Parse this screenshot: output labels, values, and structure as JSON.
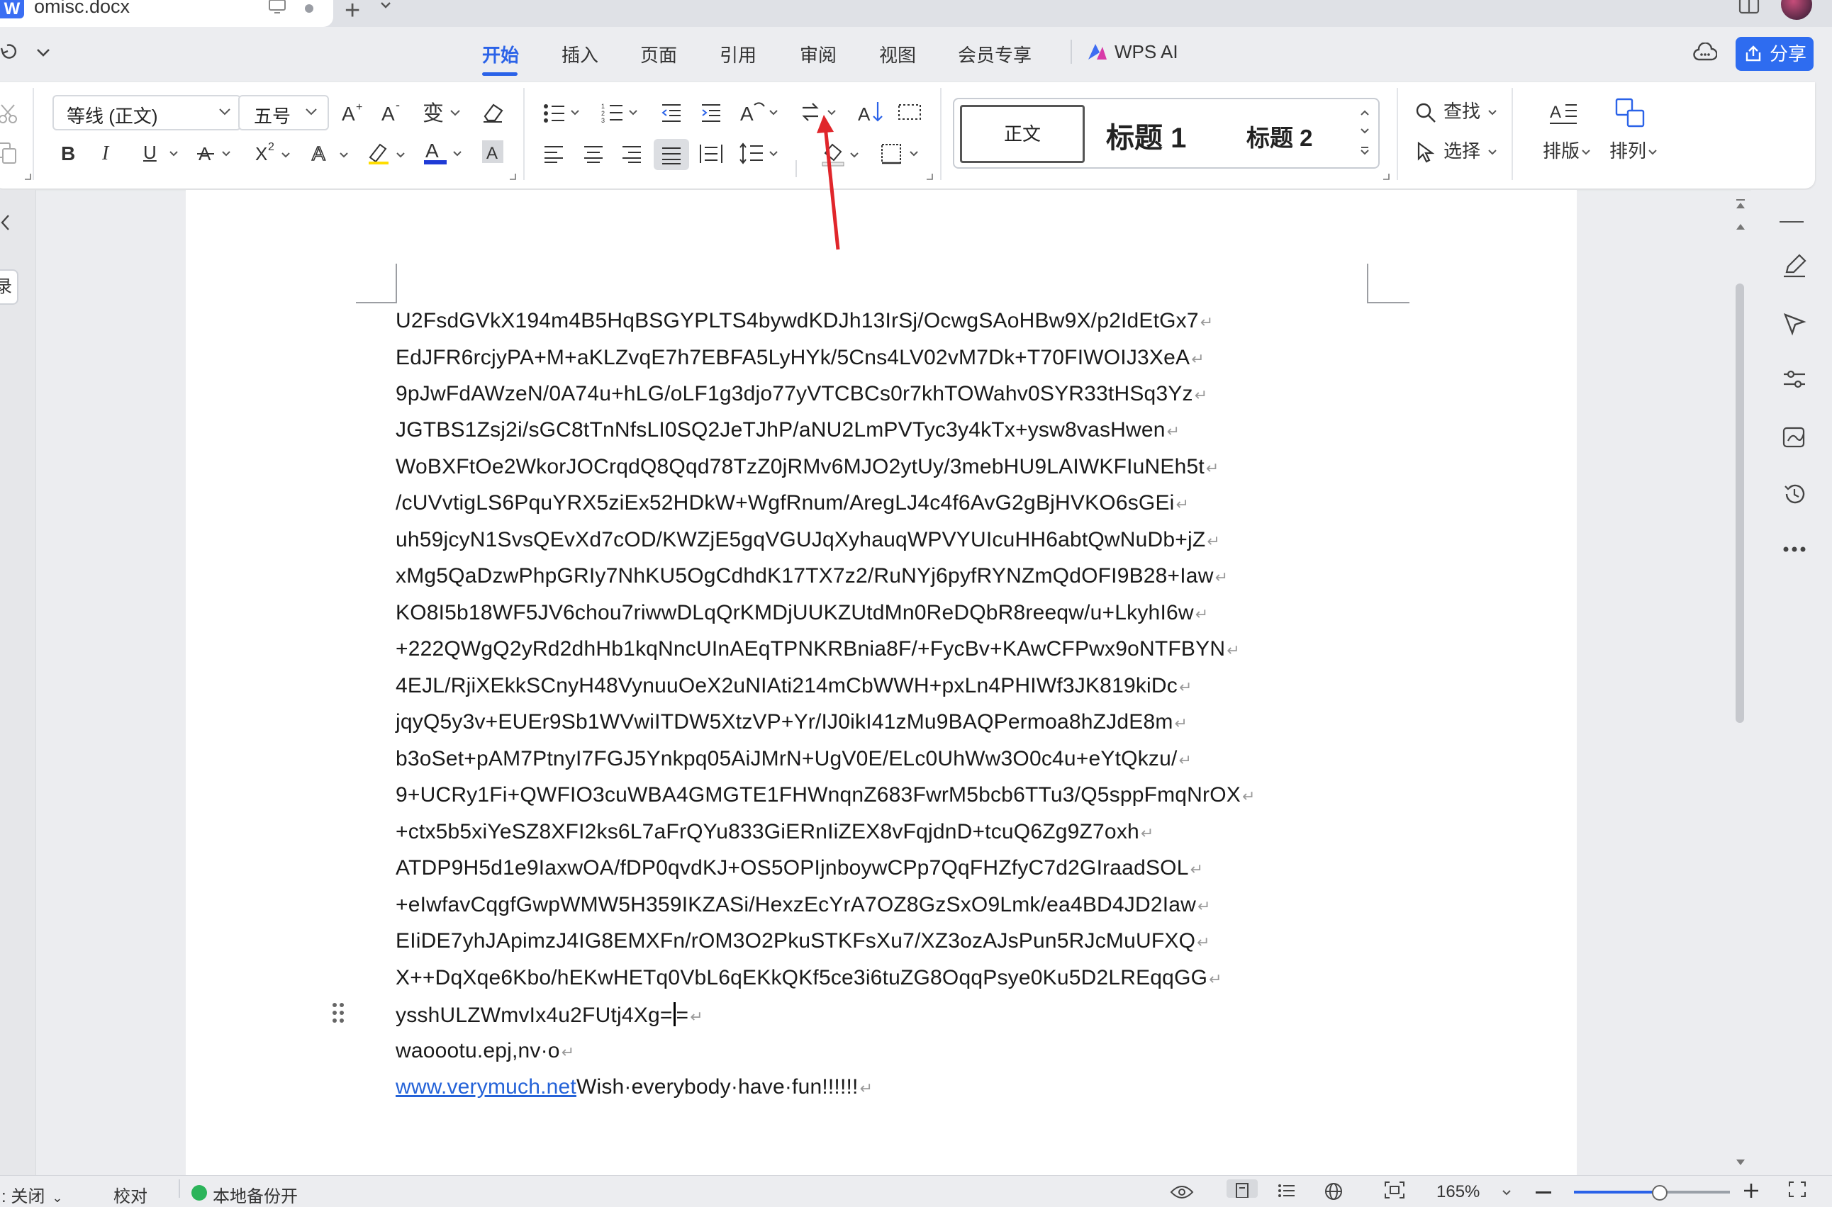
{
  "titlebar": {
    "doc_name": "omisc.docx",
    "new_tab": "+"
  },
  "menu": {
    "tabs": [
      "开始",
      "插入",
      "页面",
      "引用",
      "审阅",
      "视图",
      "会员专享"
    ],
    "active_tab": "开始",
    "wps_ai": "WPS AI",
    "share": "分享"
  },
  "ribbon": {
    "font_name": "等线 (正文)",
    "font_size": "五号",
    "bold": "B",
    "italic": "I",
    "underline": "U",
    "find": "查找",
    "select": "选择",
    "layout": "排版",
    "arrange": "排列",
    "styles": {
      "normal": "正文",
      "heading1": "标题 1",
      "heading2": "标题 2"
    }
  },
  "sidebar": {
    "toc_button": "录"
  },
  "document": {
    "lines": [
      "U2FsdGVkX194m4B5HqBSGYPLTS4bywdKDJh13IrSj/OcwgSAoHBw9X/p2IdEtGx7",
      "EdJFR6rcjyPA+M+aKLZvqE7h7EBFA5LyHYk/5Cns4LV02vM7Dk+T70FIWOIJ3XeA",
      "9pJwFdAWzeN/0A74u+hLG/oLF1g3djo77yVTCBCs0r7khTOWahv0SYR33tHSq3Yz",
      "JGTBS1Zsj2i/sGC8tTnNfsLI0SQ2JeTJhP/aNU2LmPVTyc3y4kTx+ysw8vasHwen",
      "WoBXFtOe2WkorJOCrqdQ8Qqd78TzZ0jRMv6MJO2ytUy/3mebHU9LAIWKFIuNEh5t",
      "/cUVvtigLS6PquYRX5ziEx52HDkW+WgfRnum/AregLJ4c4f6AvG2gBjHVKO6sGEi",
      "uh59jcyN1SvsQEvXd7cOD/KWZjE5gqVGUJqXyhauqWPVYUIcuHH6abtQwNuDb+jZ",
      "xMg5QaDzwPhpGRIy7NhKU5OgCdhdK17TX7z2/RuNYj6pyfRYNZmQdOFI9B28+Iaw",
      "KO8I5b18WF5JV6chou7riwwDLqQrKMDjUUKZUtdMn0ReDQbR8reeqw/u+LkyhI6w",
      "+222QWgQ2yRd2dhHb1kqNncUInAEqTPNKRBnia8F/+FycBv+KAwCFPwx9oNTFBYN",
      "4EJL/RjiXEkkSCnyH48VynuuOeX2uNIAti214mCbWWH+pxLn4PHIWf3JK819kiDc",
      "jqyQ5y3v+EUEr9Sb1WVwiITDW5XtzVP+Yr/IJ0ikI41zMu9BAQPermoa8hZJdE8m",
      "b3oSet+pAM7PtnyI7FGJ5Ynkpq05AiJMrN+UgV0E/ELc0UhWw3O0c4u+eYtQkzu/",
      "9+UCRy1Fi+QWFIO3cuWBA4GMGTE1FHWnqnZ683FwrM5bcb6TTu3/Q5sppFmqNrOX",
      "+ctx5b5xiYeSZ8XFI2ks6L7aFrQYu833GiERnIiZEX8vFqjdnD+tcuQ6Zg9Z7oxh",
      "ATDP9H5d1e9IaxwOA/fDP0qvdKJ+OS5OPIjnboywCPp7QqFHZfyC7d2GIraadSOL",
      "+eIwfavCqgfGwpWMW5H359IKZASi/HexzEcYrA7OZ8GzSxO9Lmk/ea4BD4JD2Iaw",
      "EIiDE7yhJApimzJ4IG8EMXFn/rOM3O2PkuSTKFsXu7/XZ3ozAJsPun5RJcMuUFXQ",
      "X++DqXqe6Kbo/hEKwHETq0VbL6qEKkQKf5ce3i6tuZG8OqqPsye0Ku5D2LREqqGG"
    ],
    "line_cursor_before": "ysshULZWmvIx4u2FUtj4Xg=",
    "line_cursor_after": "=",
    "line_plain": "waoootu.epj,nv·o",
    "link_text": "www.verymuch.net",
    "link_tail": "Wish·everybody·have·fun!!!!!!"
  },
  "status": {
    "spell_off": "关闭",
    "proofread": "校对",
    "backup": "本地备份开",
    "zoom": "165%"
  },
  "colors": {
    "accent": "#2a62e8",
    "share_button": "#2e6cf0",
    "link": "#2563d8",
    "annotation_arrow": "#e0262b"
  }
}
